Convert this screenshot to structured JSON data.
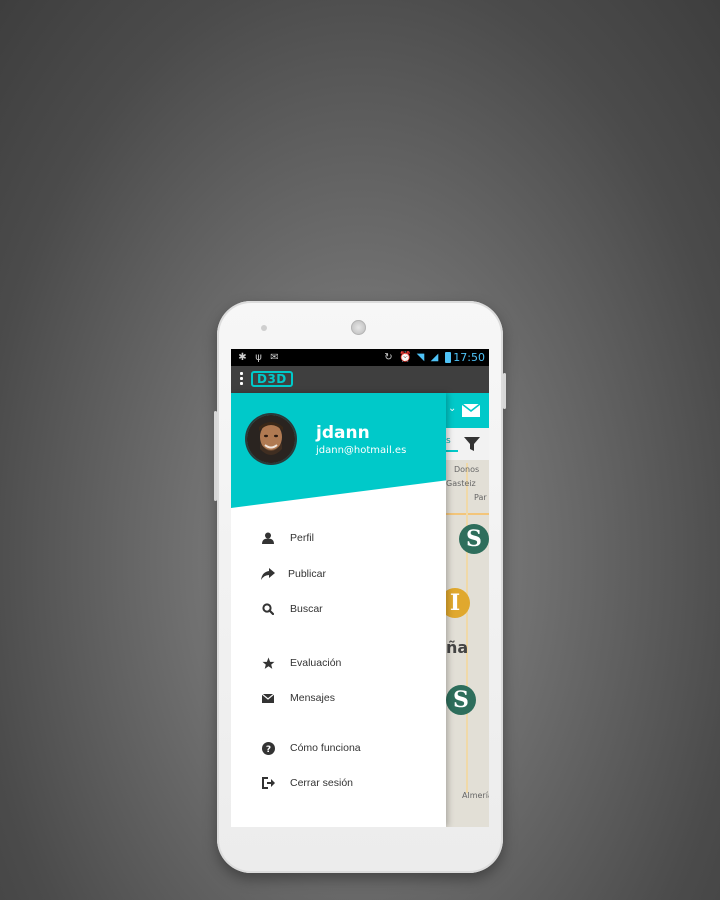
{
  "statusbar": {
    "time": "17:50"
  },
  "appbar": {
    "logo_text": "D3D"
  },
  "user": {
    "name": "jdann",
    "email": "jdann@hotmail.es"
  },
  "menu": {
    "items": [
      {
        "label": "Perfil",
        "icon": "user-icon"
      },
      {
        "label": "Publicar",
        "icon": "share-arrow-icon"
      },
      {
        "label": "Buscar",
        "icon": "search-icon"
      },
      {
        "label": "Evaluación",
        "icon": "star-icon"
      },
      {
        "label": "Mensajes",
        "icon": "envelope-icon"
      },
      {
        "label": "Cómo funciona",
        "icon": "question-icon"
      },
      {
        "label": "Cerrar sesión",
        "icon": "sign-out-icon"
      }
    ]
  },
  "map": {
    "labels": [
      "Donos",
      "Gasteiz",
      "Par",
      "ña",
      "Almería"
    ],
    "pins": [
      "S",
      "I",
      "S"
    ],
    "partial_tab": "s"
  },
  "colors": {
    "accent": "#00c9c9",
    "appbar": "#3f3f3f",
    "pin_green": "#2e6e5c",
    "pin_yellow": "#e0a82e"
  }
}
